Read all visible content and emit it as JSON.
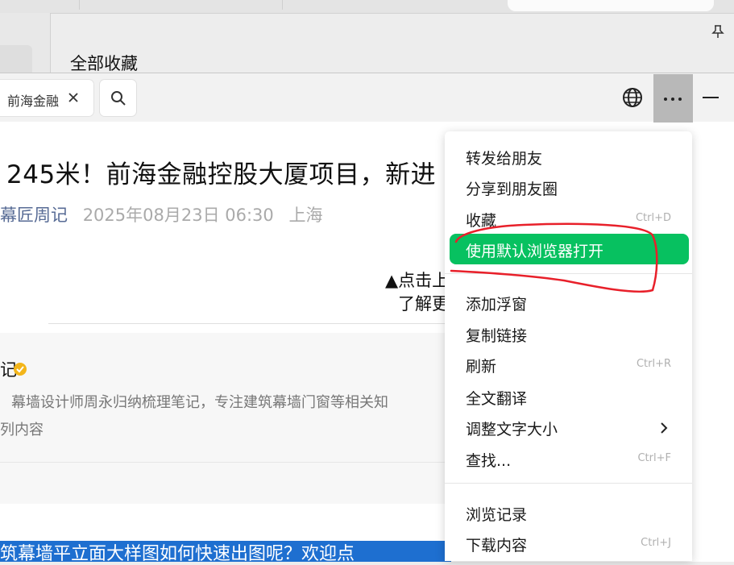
{
  "background_window": {
    "favorites_title": "全部收藏",
    "pin_icon": "pin-icon"
  },
  "browser": {
    "tab_title": "前海金融",
    "icons": {
      "close": "close-icon",
      "search": "search-icon",
      "globe": "globe-icon",
      "more": "more-icon",
      "minimize": "minimize-icon"
    }
  },
  "article": {
    "title": "245米！前海金融控股大厦项目，新进",
    "author": "幕匠周记",
    "date": "2025年08月23日 06:30",
    "location": "上海",
    "caption_line1": "▲点击上",
    "caption_line2": "了解更",
    "profile_name": "记",
    "profile_desc_line1": "幕墙设计师周永归纳梳理笔记，专注建筑幕墙门窗等相关知",
    "profile_desc_line2": "列内容",
    "banner_text": "筑幕墙平立面大样图如何快速出图呢？欢迎点"
  },
  "menu": {
    "items": [
      {
        "label": "转发给朋友",
        "shortcut": ""
      },
      {
        "label": "分享到朋友圈",
        "shortcut": ""
      },
      {
        "label": "收藏",
        "shortcut": "Ctrl+D"
      },
      {
        "label": "使用默认浏览器打开",
        "shortcut": ""
      },
      {
        "label": "添加浮窗",
        "shortcut": ""
      },
      {
        "label": "复制链接",
        "shortcut": ""
      },
      {
        "label": "刷新",
        "shortcut": "Ctrl+R"
      },
      {
        "label": "全文翻译",
        "shortcut": ""
      },
      {
        "label": "调整文字大小",
        "shortcut": ""
      },
      {
        "label": "查找...",
        "shortcut": "Ctrl+F"
      },
      {
        "label": "浏览记录",
        "shortcut": ""
      },
      {
        "label": "下载内容",
        "shortcut": "Ctrl+J"
      }
    ],
    "active_color": "#07c160"
  },
  "annotation_color": "#e8202a"
}
